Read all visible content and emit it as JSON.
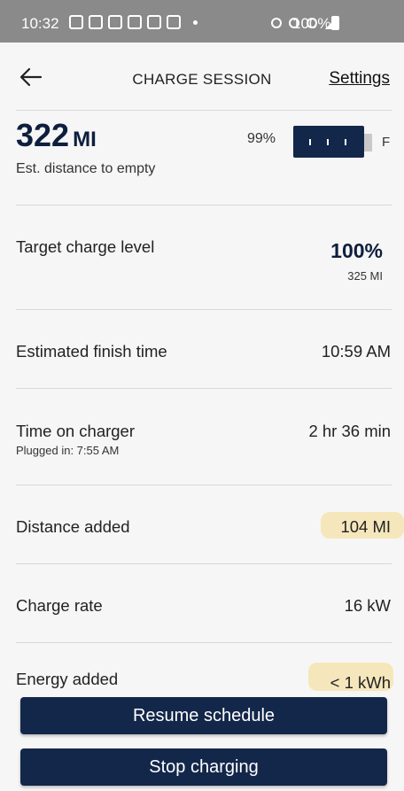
{
  "status_bar": {
    "time": "10:32",
    "battery_pct": "100%"
  },
  "header": {
    "title": "CHARGE SESSION",
    "settings_label": "Settings"
  },
  "range": {
    "value": "322",
    "unit": "MI",
    "label": "Est. distance to empty",
    "battery_pct": "99%",
    "full_marker": "F",
    "battery_level": 0.99
  },
  "rows": {
    "target": {
      "label": "Target charge level",
      "value": "100%",
      "sub": "325 MI"
    },
    "finish": {
      "label": "Estimated finish time",
      "value": "10:59 AM"
    },
    "time_on_charger": {
      "label": "Time on charger",
      "sub": "Plugged in: 7:55 AM",
      "value": "2 hr 36 min"
    },
    "distance_added": {
      "label": "Distance added",
      "value": "104 MI"
    },
    "charge_rate": {
      "label": "Charge rate",
      "value": "16 kW"
    },
    "energy_added": {
      "label": "Energy added",
      "value": "< 1 kWh"
    }
  },
  "buttons": {
    "resume": "Resume schedule",
    "stop": "Stop charging"
  },
  "colors": {
    "accent": "#13274a",
    "highlight": "#f4e4b0"
  }
}
